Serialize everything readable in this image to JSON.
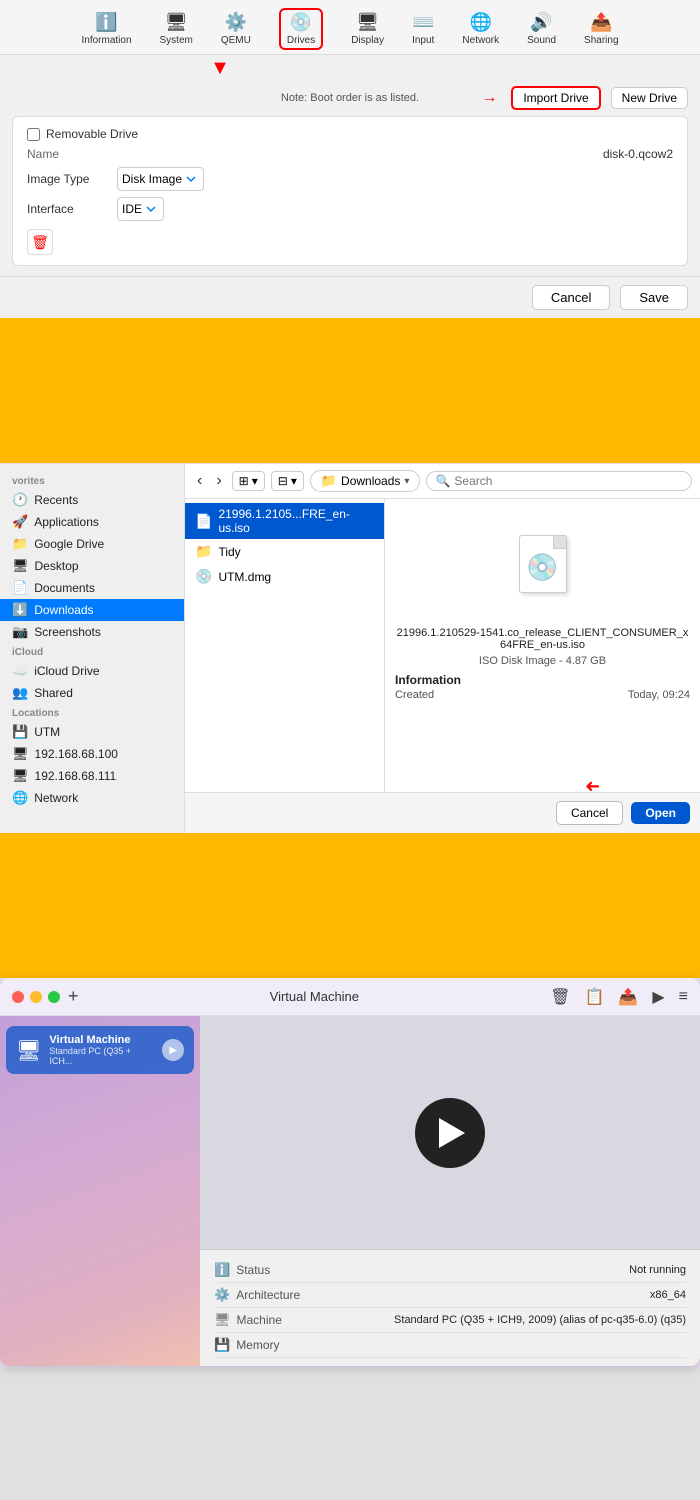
{
  "section1": {
    "toolbar": {
      "items": [
        {
          "id": "information",
          "label": "Information",
          "icon": "ℹ️"
        },
        {
          "id": "system",
          "label": "System",
          "icon": "🖥"
        },
        {
          "id": "qemu",
          "label": "QEMU",
          "icon": "🔧"
        },
        {
          "id": "drives",
          "label": "Drives",
          "icon": "💿",
          "active": true
        },
        {
          "id": "display",
          "label": "Display",
          "icon": "🖥"
        },
        {
          "id": "input",
          "label": "Input",
          "icon": "⌨️"
        },
        {
          "id": "network",
          "label": "Network",
          "icon": "🌐"
        },
        {
          "id": "sound",
          "label": "Sound",
          "icon": "🔊"
        },
        {
          "id": "sharing",
          "label": "Sharing",
          "icon": "📤"
        }
      ]
    },
    "note": "Note: Boot order is as listed.",
    "import_drive_label": "Import Drive",
    "new_drive_label": "New Drive",
    "removable_drive_label": "Removable Drive",
    "name_label": "Name",
    "name_value": "disk-0.qcow2",
    "image_type_label": "Image Type",
    "image_type_value": "Disk Image",
    "interface_label": "Interface",
    "interface_value": "IDE",
    "cancel_label": "Cancel",
    "save_label": "Save"
  },
  "section2": {
    "sidebar": {
      "favorites_label": "Favorites",
      "items_favorites": [
        {
          "id": "recents",
          "label": "Recents",
          "icon": "🕐"
        },
        {
          "id": "applications",
          "label": "Applications",
          "icon": "🚀"
        },
        {
          "id": "google_drive",
          "label": "Google Drive",
          "icon": "📁"
        },
        {
          "id": "desktop",
          "label": "Desktop",
          "icon": "🖥"
        },
        {
          "id": "documents",
          "label": "Documents",
          "icon": "📄"
        },
        {
          "id": "downloads",
          "label": "Downloads",
          "icon": "⬇️",
          "active": true
        },
        {
          "id": "screenshots",
          "label": "Screenshots",
          "icon": "📷"
        }
      ],
      "icloud_label": "iCloud",
      "items_icloud": [
        {
          "id": "icloud_drive",
          "label": "iCloud Drive",
          "icon": "☁️"
        },
        {
          "id": "shared",
          "label": "Shared",
          "icon": "👥"
        }
      ],
      "locations_label": "Locations",
      "items_locations": [
        {
          "id": "utm",
          "label": "UTM",
          "icon": "💾"
        },
        {
          "id": "ip1",
          "label": "192.168.68.100",
          "icon": "🖥"
        },
        {
          "id": "ip2",
          "label": "192.168.68.111",
          "icon": "🖥"
        },
        {
          "id": "network",
          "label": "Network",
          "icon": "🌐"
        }
      ]
    },
    "toolbar": {
      "location": "Downloads",
      "search_placeholder": "Search"
    },
    "files": [
      {
        "id": "iso",
        "name": "21996.1.2105...FRE_en-us.iso",
        "icon": "📄",
        "selected": true
      },
      {
        "id": "tidy",
        "name": "Tidy",
        "icon": "📁"
      },
      {
        "id": "utm_dmg",
        "name": "UTM.dmg",
        "icon": "💿"
      }
    ],
    "preview": {
      "full_name": "21996.1.210529-1541.co_release_CLIENT_CONSUMER_x64FRE_en-us.iso",
      "type": "ISO Disk Image - 4.87 GB",
      "info_label": "Information",
      "created_label": "Created",
      "created_value": "Today, 09:24"
    },
    "cancel_label": "Cancel",
    "open_label": "Open"
  },
  "section3": {
    "titlebar": {
      "title": "Virtual Machine"
    },
    "vm_item": {
      "label": "Virtual Machine",
      "sublabel": "Standard PC (Q35 + ICH...",
      "icon": "🖥"
    },
    "info_rows": [
      {
        "icon": "ℹ️",
        "label": "Status",
        "value": "Not running"
      },
      {
        "icon": "🔧",
        "label": "Architecture",
        "value": "x86_64"
      },
      {
        "icon": "🖥",
        "label": "Machine",
        "value": "Standard PC (Q35 + ICH9, 2009) (alias of pc-q35-6.0) (q35)"
      },
      {
        "icon": "💾",
        "label": "Memory",
        "value": ""
      }
    ]
  }
}
